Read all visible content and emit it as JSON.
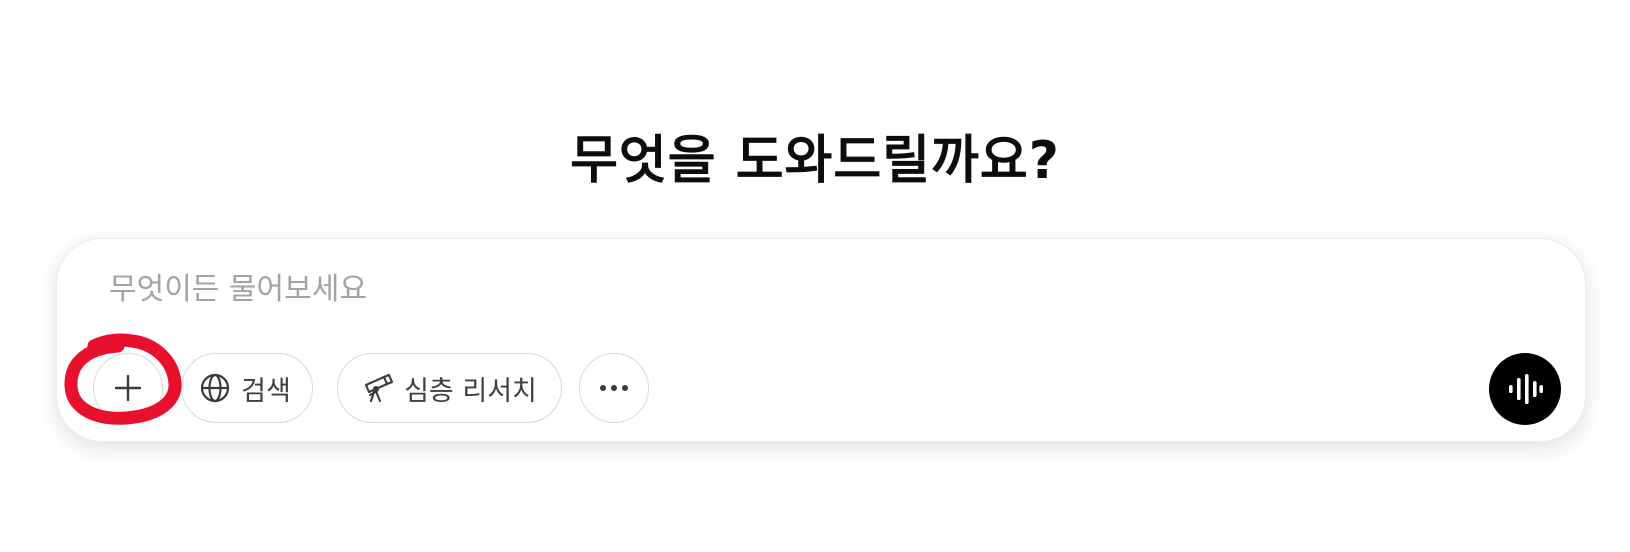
{
  "heading": "무엇을 도와드릴까요?",
  "composer": {
    "placeholder": "무엇이든 물어보세요",
    "value": ""
  },
  "toolbar": {
    "add_icon": "plus-icon",
    "search_label": "검색",
    "search_icon": "globe-icon",
    "research_label": "심층 리서치",
    "research_icon": "telescope-icon",
    "more_icon": "ellipsis-icon",
    "voice_icon": "voice-waveform-icon"
  },
  "annotation": {
    "shape": "hand-drawn circle around add button",
    "color": "#e8112d"
  },
  "colors": {
    "text": "#0d0d0d",
    "placeholder": "#a3a3a3",
    "pill_border": "#d9d9d9",
    "voice_button": "#000000"
  }
}
